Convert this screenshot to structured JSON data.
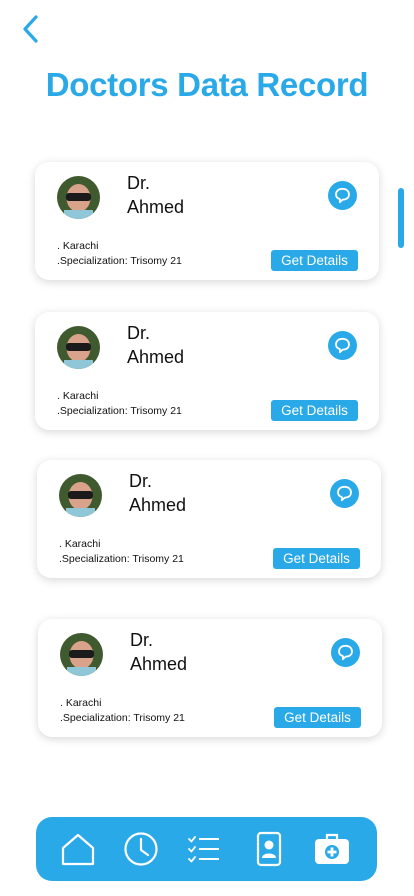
{
  "header": {
    "back_icon": "chevron-left-icon",
    "title": "Doctors Data Record"
  },
  "colors": {
    "accent": "#2aa9e8",
    "text": "#111111",
    "card_bg": "#ffffff"
  },
  "doctors": [
    {
      "name_line1": "Dr.",
      "name_line2": "Ahmed",
      "location": ". Karachi",
      "specialization": ".Specialization: Trisomy 21",
      "details_label": "Get Details"
    },
    {
      "name_line1": "Dr.",
      "name_line2": "Ahmed",
      "location": ". Karachi",
      "specialization": ".Specialization: Trisomy 21",
      "details_label": "Get Details"
    },
    {
      "name_line1": "Dr.",
      "name_line2": "Ahmed",
      "location": ". Karachi",
      "specialization": ".Specialization: Trisomy 21",
      "details_label": "Get Details"
    },
    {
      "name_line1": "Dr.",
      "name_line2": "Ahmed",
      "location": ". Karachi",
      "specialization": ".Specialization: Trisomy 21",
      "details_label": "Get Details"
    }
  ],
  "bottom_nav": {
    "items": [
      "home-icon",
      "clock-icon",
      "checklist-icon",
      "contact-card-icon",
      "medical-kit-icon"
    ]
  }
}
